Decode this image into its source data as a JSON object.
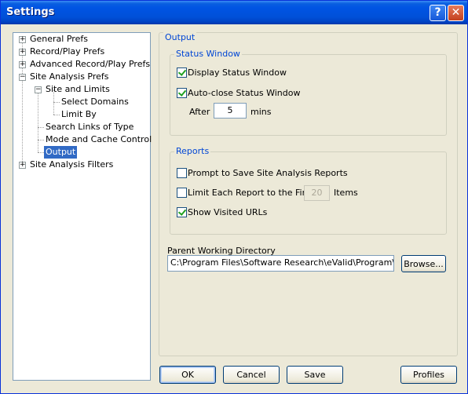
{
  "window": {
    "title": "Settings"
  },
  "tree": {
    "items": [
      {
        "label": "General Prefs"
      },
      {
        "label": "Record/Play Prefs"
      },
      {
        "label": "Advanced Record/Play Prefs"
      },
      {
        "label": "Site Analysis Prefs"
      },
      {
        "label": "Site and Limits"
      },
      {
        "label": "Select Domains"
      },
      {
        "label": "Limit By"
      },
      {
        "label": "Search Links of Type"
      },
      {
        "label": "Mode and Cache Control"
      },
      {
        "label": "Output"
      },
      {
        "label": "Site Analysis Filters"
      }
    ],
    "selected": "Output"
  },
  "output": {
    "title": "Output",
    "status_window": {
      "title": "Status Window",
      "display_label": "Display Status Window",
      "display_checked": true,
      "autoclose_label": "Auto-close Status Window",
      "autoclose_checked": true,
      "after_label": "After",
      "after_value": "5",
      "mins_label": "mins"
    },
    "reports": {
      "title": "Reports",
      "prompt_label": "Prompt to Save Site Analysis Reports",
      "prompt_checked": false,
      "limit_label": "Limit Each Report to the First",
      "limit_checked": false,
      "limit_value": "20",
      "items_label": "Items",
      "visited_label": "Show Visited URLs",
      "visited_checked": true
    },
    "parent_dir": {
      "label": "Parent Working Directory",
      "value": "C:\\Program Files\\Software Research\\eValid\\Program\\Docs\\",
      "browse_label": "Browse..."
    }
  },
  "buttons": {
    "ok": "OK",
    "cancel": "Cancel",
    "save": "Save",
    "profiles": "Profiles"
  }
}
